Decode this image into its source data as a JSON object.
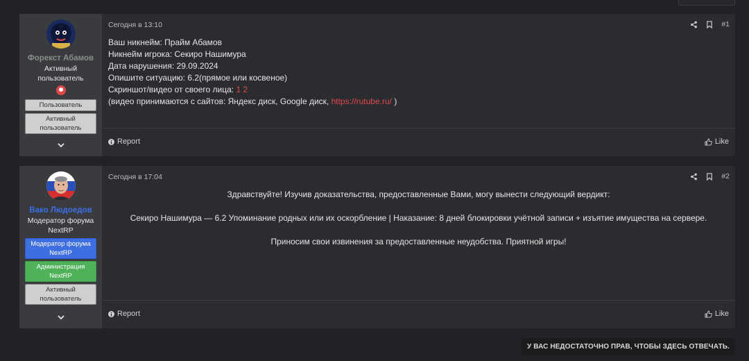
{
  "colors": {
    "page_bg": "#212225",
    "post_bg": "#2b2c2f",
    "user_col_bg": "#3a3b3f",
    "link": "#e0484f",
    "username_forex": "#8a8e8a",
    "username_vako": "#3c6fe4"
  },
  "posts": [
    {
      "author": {
        "name": "Форекст Абамов",
        "title": "Активный пользователь",
        "banners": [
          "Пользователь",
          "Активный пользователь"
        ]
      },
      "date": "Сегодня в 13:10",
      "number": "#1",
      "body": {
        "line1": "Ваш никнейм: Прайм Абамов",
        "line2": "Никнейм игрока: Секиро Нашимура",
        "line3": "Дата нарушения: 29.09.2024",
        "line4": "Опишите ситуацию: 6.2(прямое или косвеное)",
        "line5_label": "Скриншот/видео от своего лица:",
        "line5_link1": "1",
        "line5_link2": "2",
        "line6_prefix": "(видео принимаются с сайтов: Яндекс диск, Google диск,",
        "line6_link": "https://rutube.ru/",
        "line6_suffix": ")"
      },
      "report_label": "Report",
      "like_label": "Like"
    },
    {
      "author": {
        "name": "Вако Людоедов",
        "title": "Модератор форума NextRP",
        "banners": [
          "Модератор форума NextRP",
          "Администрация NextRP",
          "Активный пользователь"
        ]
      },
      "date": "Сегодня в 17:04",
      "number": "#2",
      "body": {
        "line1": "Здравствуйте! Изучив доказательства, предоставленные Вами, могу вынести следующий вердикт:",
        "line2": "Секиро Нашимура — 6.2 Упоминание родных или их оскорбление | Наказание: 8 дней блокировки учётной записи + изъятие имущества на сервере.",
        "line3": "Приносим свои извинения за предоставленные неудобства. Приятной игры!"
      },
      "report_label": "Report",
      "like_label": "Like"
    }
  ],
  "footer_notice": "У ВАС НЕДОСТАТОЧНО ПРАВ, ЧТОБЫ ЗДЕСЬ ОТВЕЧАТЬ.",
  "icons": [
    "share-icon",
    "bookmark-icon",
    "chevron-down-icon",
    "info-icon",
    "thumbs-up-icon",
    "role-badge-icon"
  ]
}
